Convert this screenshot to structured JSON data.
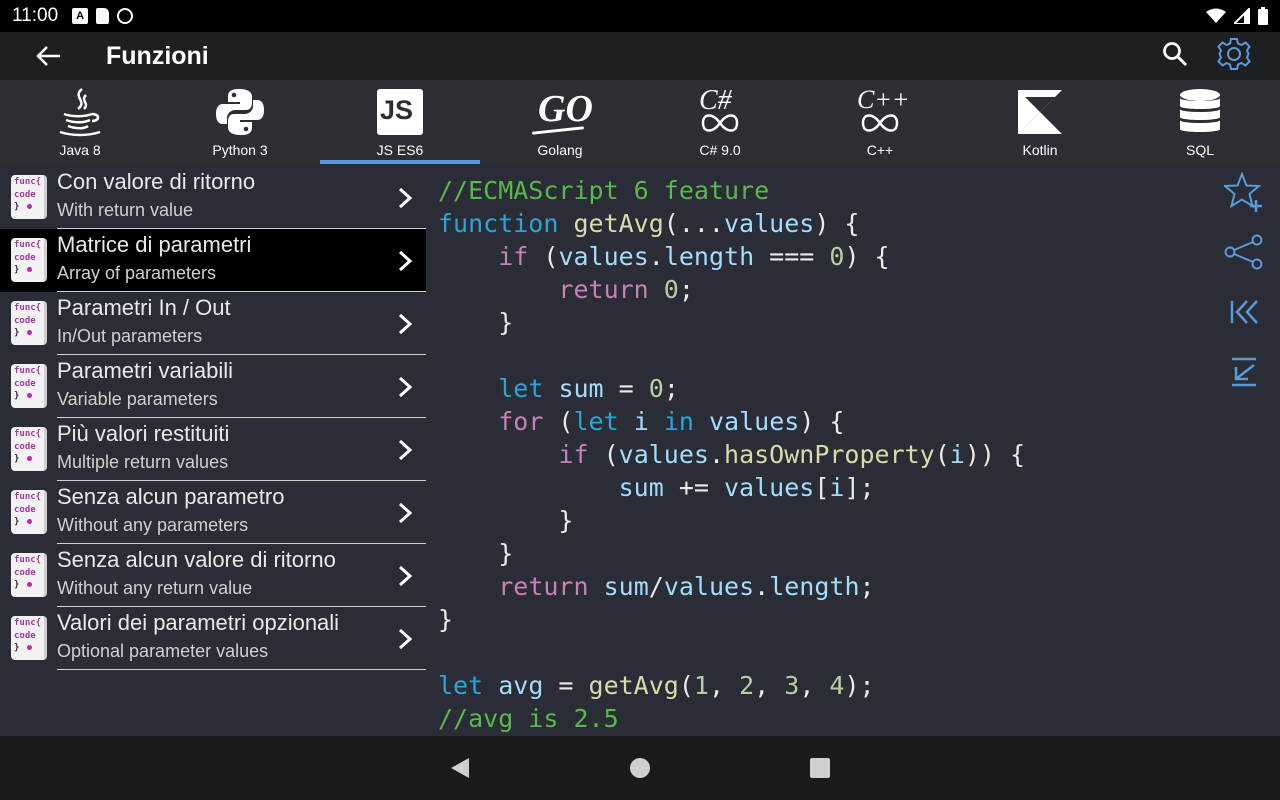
{
  "status": {
    "time": "11:00",
    "icons": [
      "notification-a-icon",
      "sd-card-icon",
      "do-not-disturb-icon"
    ],
    "right_icons": [
      "wifi-icon",
      "cellular-signal-icon",
      "battery-icon"
    ]
  },
  "appbar": {
    "title": "Funzioni",
    "back_icon": "arrow-back-icon",
    "search_icon": "search-icon",
    "settings_icon": "gear-icon",
    "accent": "#5a9ad8"
  },
  "tabs": [
    {
      "label": "Java 8",
      "icon": "java-icon"
    },
    {
      "label": "Python 3",
      "icon": "python-icon"
    },
    {
      "label": "JS ES6",
      "icon": "js-icon",
      "badge": "JS",
      "active": true
    },
    {
      "label": "Golang",
      "icon": "golang-icon",
      "badge": "GO"
    },
    {
      "label": "C# 9.0",
      "icon": "csharp-icon",
      "badge": "C#"
    },
    {
      "label": "C++",
      "icon": "cpp-icon",
      "badge": "C++"
    },
    {
      "label": "Kotlin",
      "icon": "kotlin-icon"
    },
    {
      "label": "SQL",
      "icon": "database-icon"
    }
  ],
  "list": {
    "badge_text": {
      "l1": "func{",
      "l2": "code",
      "l3": "}"
    },
    "items": [
      {
        "title": "Con valore di ritorno",
        "subtitle": "With return value",
        "active": false
      },
      {
        "title": "Matrice di parametri",
        "subtitle": "Array of parameters",
        "active": true
      },
      {
        "title": "Parametri In / Out",
        "subtitle": "In/Out parameters",
        "active": false
      },
      {
        "title": "Parametri variabili",
        "subtitle": "Variable parameters",
        "active": false
      },
      {
        "title": "Più valori restituiti",
        "subtitle": "Multiple return values",
        "active": false
      },
      {
        "title": "Senza alcun parametro",
        "subtitle": "Without any parameters",
        "active": false
      },
      {
        "title": "Senza alcun valore di ritorno",
        "subtitle": "Without any return value",
        "active": false
      },
      {
        "title": "Valori dei parametri opzionali",
        "subtitle": "Optional parameter values",
        "active": false
      }
    ]
  },
  "code": {
    "lines": [
      [
        {
          "t": "//ECMAScript 6 feature",
          "c": "com"
        }
      ],
      [
        {
          "t": "function ",
          "c": "kw"
        },
        {
          "t": "getAvg",
          "c": "fn"
        },
        {
          "t": "(...",
          "c": "pl"
        },
        {
          "t": "values",
          "c": "var"
        },
        {
          "t": ") {",
          "c": "pl"
        }
      ],
      [
        {
          "t": "    ",
          "c": "pl"
        },
        {
          "t": "if",
          "c": "ctl"
        },
        {
          "t": " (",
          "c": "pl"
        },
        {
          "t": "values",
          "c": "var"
        },
        {
          "t": ".",
          "c": "pl"
        },
        {
          "t": "length",
          "c": "var"
        },
        {
          "t": " === ",
          "c": "pl"
        },
        {
          "t": "0",
          "c": "num"
        },
        {
          "t": ") {",
          "c": "pl"
        }
      ],
      [
        {
          "t": "        ",
          "c": "pl"
        },
        {
          "t": "return",
          "c": "ctl"
        },
        {
          "t": " ",
          "c": "pl"
        },
        {
          "t": "0",
          "c": "num"
        },
        {
          "t": ";",
          "c": "pl"
        }
      ],
      [
        {
          "t": "    }",
          "c": "pl"
        }
      ],
      [
        {
          "t": "",
          "c": "pl"
        }
      ],
      [
        {
          "t": "    ",
          "c": "pl"
        },
        {
          "t": "let",
          "c": "kw"
        },
        {
          "t": " ",
          "c": "pl"
        },
        {
          "t": "sum",
          "c": "var"
        },
        {
          "t": " = ",
          "c": "pl"
        },
        {
          "t": "0",
          "c": "num"
        },
        {
          "t": ";",
          "c": "pl"
        }
      ],
      [
        {
          "t": "    ",
          "c": "pl"
        },
        {
          "t": "for",
          "c": "ctl"
        },
        {
          "t": " (",
          "c": "pl"
        },
        {
          "t": "let",
          "c": "kw"
        },
        {
          "t": " ",
          "c": "pl"
        },
        {
          "t": "i",
          "c": "var"
        },
        {
          "t": " ",
          "c": "pl"
        },
        {
          "t": "in",
          "c": "kw"
        },
        {
          "t": " ",
          "c": "pl"
        },
        {
          "t": "values",
          "c": "var"
        },
        {
          "t": ") {",
          "c": "pl"
        }
      ],
      [
        {
          "t": "        ",
          "c": "pl"
        },
        {
          "t": "if",
          "c": "ctl"
        },
        {
          "t": " (",
          "c": "pl"
        },
        {
          "t": "values",
          "c": "var"
        },
        {
          "t": ".",
          "c": "pl"
        },
        {
          "t": "hasOwnProperty",
          "c": "fn"
        },
        {
          "t": "(",
          "c": "pl"
        },
        {
          "t": "i",
          "c": "var"
        },
        {
          "t": ")) {",
          "c": "pl"
        }
      ],
      [
        {
          "t": "            ",
          "c": "pl"
        },
        {
          "t": "sum",
          "c": "var"
        },
        {
          "t": " += ",
          "c": "pl"
        },
        {
          "t": "values",
          "c": "var"
        },
        {
          "t": "[",
          "c": "pl"
        },
        {
          "t": "i",
          "c": "var"
        },
        {
          "t": "];",
          "c": "pl"
        }
      ],
      [
        {
          "t": "        }",
          "c": "pl"
        }
      ],
      [
        {
          "t": "    }",
          "c": "pl"
        }
      ],
      [
        {
          "t": "    ",
          "c": "pl"
        },
        {
          "t": "return",
          "c": "ctl"
        },
        {
          "t": " ",
          "c": "pl"
        },
        {
          "t": "sum",
          "c": "var"
        },
        {
          "t": "/",
          "c": "pl"
        },
        {
          "t": "values",
          "c": "var"
        },
        {
          "t": ".",
          "c": "pl"
        },
        {
          "t": "length",
          "c": "var"
        },
        {
          "t": ";",
          "c": "pl"
        }
      ],
      [
        {
          "t": "}",
          "c": "pl"
        }
      ],
      [
        {
          "t": "",
          "c": "pl"
        }
      ],
      [
        {
          "t": "let",
          "c": "kw"
        },
        {
          "t": " ",
          "c": "pl"
        },
        {
          "t": "avg",
          "c": "var"
        },
        {
          "t": " = ",
          "c": "pl"
        },
        {
          "t": "getAvg",
          "c": "fn"
        },
        {
          "t": "(",
          "c": "pl"
        },
        {
          "t": "1",
          "c": "num"
        },
        {
          "t": ", ",
          "c": "pl"
        },
        {
          "t": "2",
          "c": "num"
        },
        {
          "t": ", ",
          "c": "pl"
        },
        {
          "t": "3",
          "c": "num"
        },
        {
          "t": ", ",
          "c": "pl"
        },
        {
          "t": "4",
          "c": "num"
        },
        {
          "t": ");",
          "c": "pl"
        }
      ],
      [
        {
          "t": "//avg is 2.5",
          "c": "com"
        }
      ]
    ]
  },
  "side_actions": [
    "favorite-add-icon",
    "share-icon",
    "first-page-icon",
    "scroll-to-end-icon"
  ],
  "navbar": [
    "nav-back-icon",
    "nav-home-icon",
    "nav-recents-icon"
  ]
}
